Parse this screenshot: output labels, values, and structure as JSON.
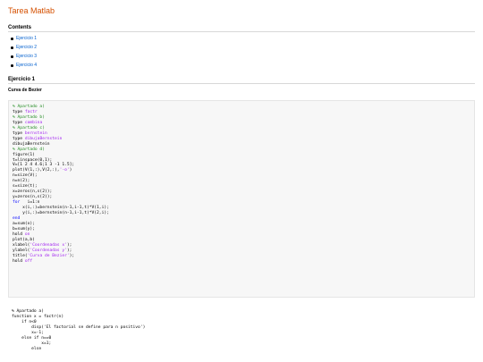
{
  "page": {
    "title": "Tarea Matlab"
  },
  "contents": {
    "heading": "Contents",
    "items": [
      "Ejercicio 1",
      "Ejercicio 2",
      "Ejercicio 3",
      "Ejercicio 4"
    ]
  },
  "section": {
    "heading": "Ejercicio 1",
    "subtitle": "Curva de Bezier"
  },
  "code_block_1": [
    [
      [
        "c",
        "% Apartado a)"
      ]
    ],
    [
      [
        "t",
        "type "
      ],
      [
        "s",
        "factr"
      ]
    ],
    [
      [
        "c",
        "% Apartado b)"
      ]
    ],
    [
      [
        "t",
        "type "
      ],
      [
        "s",
        "combina"
      ]
    ],
    [
      [
        "c",
        "% Apartado c)"
      ]
    ],
    [
      [
        "t",
        "type "
      ],
      [
        "s",
        "bernstein"
      ]
    ],
    [
      [
        "t",
        "type "
      ],
      [
        "s",
        "dibujaBernstein"
      ]
    ],
    [
      [
        "t",
        "dibujaBernstein"
      ]
    ],
    [
      [
        "c",
        "% Apartado d)"
      ]
    ],
    [
      [
        "t",
        "figure(1)"
      ]
    ],
    [
      [
        "t",
        "t=linspace(0,1);"
      ]
    ],
    [
      [
        "t",
        "V=[1 2 4 4.6;1 3 -1 1.5];"
      ]
    ],
    [
      [
        "t",
        "plot(V(1,:),V(2,:),"
      ],
      [
        "s",
        "'-o'"
      ],
      [
        "t",
        ")"
      ]
    ],
    [
      [
        "t",
        "n=size(V);"
      ]
    ],
    [
      [
        "t",
        "n=n(2);"
      ]
    ],
    [
      [
        "t",
        "s=size(t);"
      ]
    ],
    [
      [
        "t",
        "x=zeros(n,s(2));"
      ]
    ],
    [
      [
        "t",
        "y=zeros(n,s(2));"
      ]
    ],
    [
      [
        "k",
        "for "
      ],
      [
        "t",
        "  i=1:n"
      ]
    ],
    [
      [
        "t",
        "    x(i,:)=bernstein(n-1,i-1,t)*V(1,i);"
      ]
    ],
    [
      [
        "t",
        "    y(i,:)=bernstein(n-1,i-1,t)*V(2,i);"
      ]
    ],
    [
      [
        "k",
        "end"
      ]
    ],
    [
      [
        "t",
        "a=sum(x);"
      ]
    ],
    [
      [
        "t",
        "b=sum(y);"
      ]
    ],
    [
      [
        "t",
        "hold "
      ],
      [
        "s",
        "on"
      ]
    ],
    [
      [
        "t",
        "plot(a,b)"
      ]
    ],
    [
      [
        "t",
        "xlabel("
      ],
      [
        "s",
        "'Coordenadas x'"
      ],
      [
        "t",
        ");"
      ]
    ],
    [
      [
        "t",
        "ylabel("
      ],
      [
        "s",
        "'Coordenadas y'"
      ],
      [
        "t",
        ");"
      ]
    ],
    [
      [
        "t",
        "title("
      ],
      [
        "s",
        "'Curva de Bezier'"
      ],
      [
        "t",
        ");"
      ]
    ],
    [
      [
        "t",
        "hold "
      ],
      [
        "s",
        "off"
      ]
    ]
  ],
  "code_block_2": [
    [
      [
        "t",
        "% Apartado a)"
      ]
    ],
    [
      [
        "t",
        "function x = factr(n)"
      ]
    ],
    [
      [
        "t",
        "    if n<0"
      ]
    ],
    [
      [
        "t",
        "        disp('El factorial se define para n positivo')"
      ]
    ],
    [
      [
        "t",
        "        x=-1;"
      ]
    ],
    [
      [
        "t",
        "    else if n==0"
      ]
    ],
    [
      [
        "t",
        "            x=1;"
      ]
    ],
    [
      [
        "t",
        "        else"
      ]
    ]
  ]
}
